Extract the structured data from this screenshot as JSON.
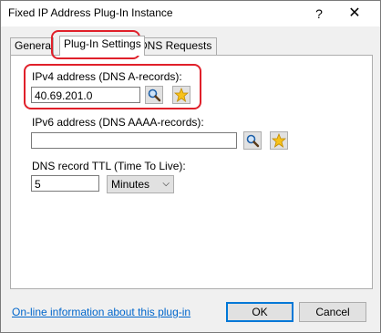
{
  "window": {
    "title": "Fixed IP Address Plug-In Instance",
    "help_label": "?",
    "close_label": "✕"
  },
  "tabs": [
    {
      "label": "General"
    },
    {
      "label": "Plug-In Settings"
    },
    {
      "label": "DNS Requests"
    }
  ],
  "panel": {
    "ipv4_label": "IPv4 address (DNS A-records):",
    "ipv4_value": "40.69.201.0",
    "ipv6_label": "IPv6 address (DNS AAAA-records):",
    "ipv6_value": "",
    "ttl_label": "DNS record TTL (Time To Live):",
    "ttl_value": "5",
    "ttl_unit": "Minutes"
  },
  "footer": {
    "link_text": "On-line information about this plug-in",
    "ok_label": "OK",
    "cancel_label": "Cancel"
  },
  "colors": {
    "highlight": "#e0202a",
    "link": "#0066cc"
  }
}
